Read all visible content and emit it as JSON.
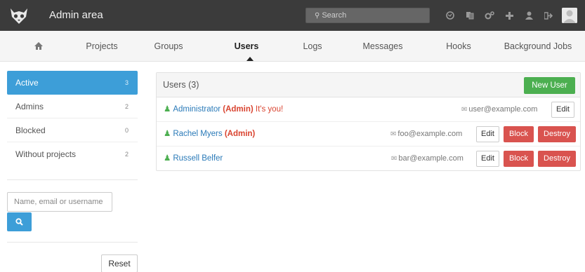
{
  "header": {
    "title": "Admin area",
    "search_placeholder": "Search",
    "icons": [
      "globe-icon",
      "copy-icon",
      "gears-icon",
      "plus-icon",
      "user-icon",
      "sign-out-icon"
    ],
    "colors": {
      "bar": "#3b3b3b"
    }
  },
  "nav": {
    "home_icon": "home-icon",
    "tabs": [
      {
        "label": "Projects"
      },
      {
        "label": "Groups"
      },
      {
        "label": "Users"
      },
      {
        "label": "Logs"
      },
      {
        "label": "Messages"
      },
      {
        "label": "Hooks"
      },
      {
        "label": "Background Jobs"
      }
    ],
    "active": "Users"
  },
  "sidebar": {
    "items": [
      {
        "label": "Active",
        "count": "3"
      },
      {
        "label": "Admins",
        "count": "2"
      },
      {
        "label": "Blocked",
        "count": "0"
      },
      {
        "label": "Without projects",
        "count": "2"
      }
    ],
    "filter_placeholder": "Name, email or username",
    "reset_label": "Reset",
    "colors": {
      "active": "#3d9ed8"
    }
  },
  "users_panel": {
    "title": "Users (3)",
    "new_user_label": "New User",
    "edit_label": "Edit",
    "block_label": "Block",
    "destroy_label": "Destroy",
    "users": [
      {
        "name": "Administrator",
        "badge": "(Admin)",
        "note": "It's you!",
        "email": "user@example.com"
      },
      {
        "name": "Rachel Myers",
        "badge": "(Admin)",
        "note": "",
        "email": "foo@example.com"
      },
      {
        "name": "Russell Belfer",
        "badge": "",
        "note": "",
        "email": "bar@example.com"
      }
    ],
    "colors": {
      "new_user": "#4caf50",
      "danger": "#d9534f",
      "admin_text": "#d9432f",
      "link": "#2a7ab8"
    }
  }
}
